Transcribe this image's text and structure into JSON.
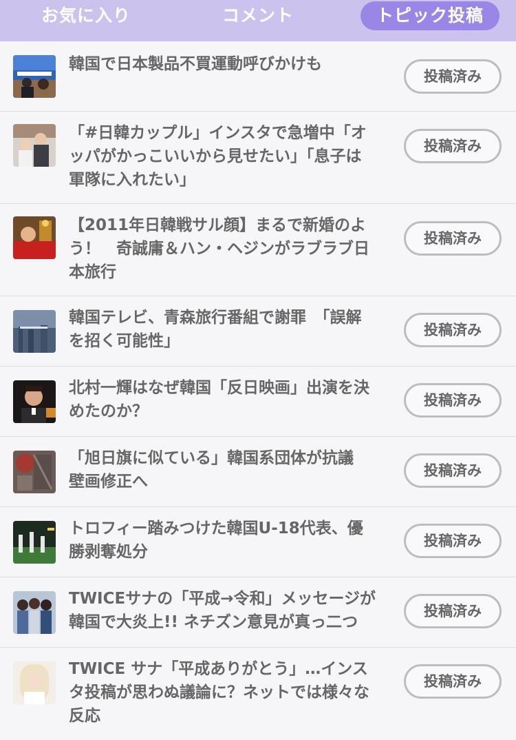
{
  "tabs": [
    {
      "label": "お気に入り",
      "active": false
    },
    {
      "label": "コメント",
      "active": false
    },
    {
      "label": "トピック投稿",
      "active": true
    }
  ],
  "colors": {
    "tabbar_bg": "#cbc3ee",
    "active_tab_bg": "#9a86e6"
  },
  "items": [
    {
      "title": "韓国で日本製品不買運動呼びかけも",
      "status": "投稿済み"
    },
    {
      "title": "「#日韓カップル」インスタで急増中「オ\nッパがかっこいいから見せたい」「息子は\n軍隊に入れたい」",
      "status": "投稿済み"
    },
    {
      "title": "【2011年日韓戦サル顔】まるで新婚のよ\nう！　奇誠庸＆ハン・ヘジンがラブラブ日\n本旅行",
      "status": "投稿済み"
    },
    {
      "title": "韓国テレビ、青森旅行番組で謝罪　「誤解\nを招く可能性」",
      "status": "投稿済み"
    },
    {
      "title": "北村一輝はなぜ韓国「反日映画」出演を決\nめたのか？",
      "status": "投稿済み"
    },
    {
      "title": "「旭日旗に似ている」韓国系団体が抗議\n壁画修正へ",
      "status": "投稿済み"
    },
    {
      "title": "トロフィー踏みつけた韓国U-18代表、優\n勝剥奪処分",
      "status": "投稿済み"
    },
    {
      "title": "TWICEサナの「平成→令和」メッセージが\n韓国で大炎上!! ネチズン意見が真っ二つ",
      "status": "投稿済み"
    },
    {
      "title": "TWICE サナ「平成ありがとう」…インス\nタ投稿が思わぬ議論に？ネットでは様々な\n反応",
      "status": "投稿済み"
    }
  ]
}
